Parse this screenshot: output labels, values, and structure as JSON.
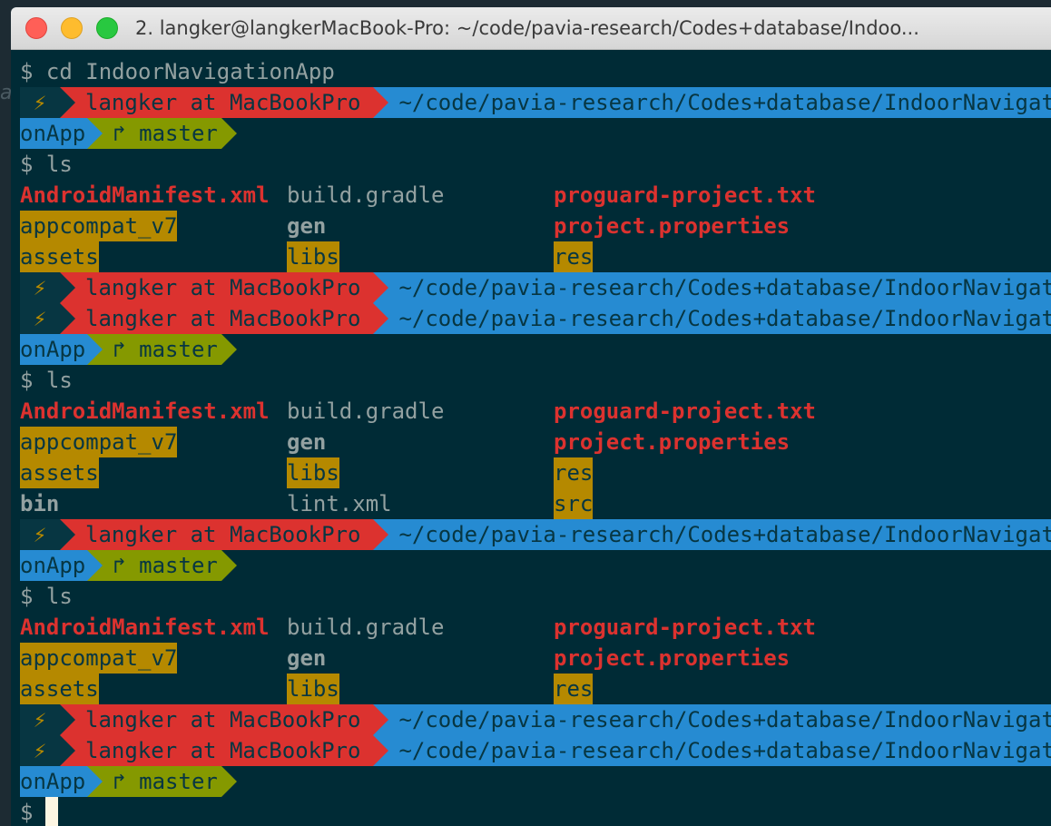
{
  "window": {
    "title": "2. langker@langkerMacBook-Pro: ~/code/pavia-research/Codes+database/Indoo..."
  },
  "side_fragment": "a",
  "prompt": {
    "bolt": "⚡",
    "user": "langker at MacBookPro",
    "path": "~/code/pavia-research/Codes+database/IndoorNavigati",
    "path_cont": "onApp",
    "branch_icon": "↱",
    "branch": "master",
    "dollar": "$"
  },
  "commands": {
    "cd": "$ cd IndoorNavigationApp",
    "ls": "$ ls"
  },
  "listing": {
    "row1": [
      "AndroidManifest.xml",
      "build.gradle",
      "proguard-project.txt"
    ],
    "row2": [
      "appcompat_v7",
      "gen",
      "project.properties"
    ],
    "row3": [
      "assets",
      "libs",
      "res"
    ],
    "row4": [
      "bin",
      "lint.xml",
      "src"
    ]
  }
}
